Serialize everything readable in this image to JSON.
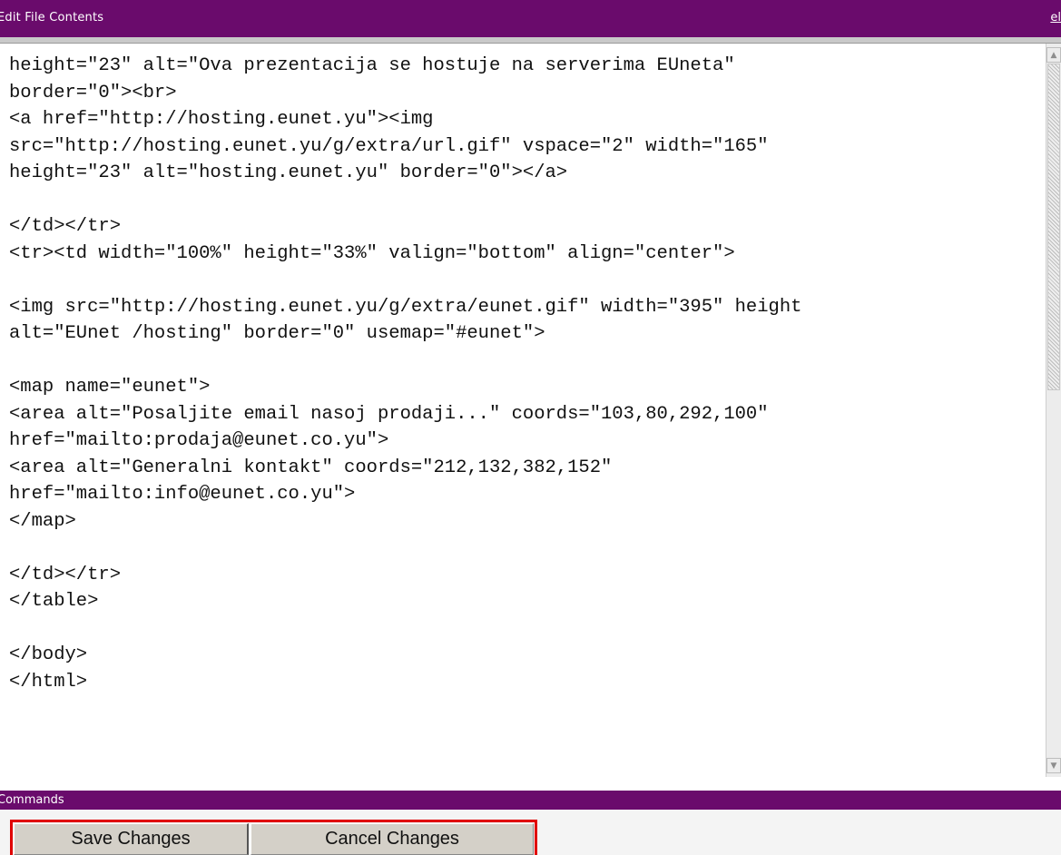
{
  "header": {
    "title": "Edit File Contents",
    "help_link": "el"
  },
  "editor": {
    "content": "height=\"23\" alt=\"Ova prezentacija se hostuje na serverima EUneta\"\nborder=\"0\"><br>\n<a href=\"http://hosting.eunet.yu\"><img\nsrc=\"http://hosting.eunet.yu/g/extra/url.gif\" vspace=\"2\" width=\"165\"\nheight=\"23\" alt=\"hosting.eunet.yu\" border=\"0\"></a>\n\n</td></tr>\n<tr><td width=\"100%\" height=\"33%\" valign=\"bottom\" align=\"center\">\n\n<img src=\"http://hosting.eunet.yu/g/extra/eunet.gif\" width=\"395\" height\nalt=\"EUnet /hosting\" border=\"0\" usemap=\"#eunet\">\n\n<map name=\"eunet\">\n<area alt=\"Posaljite email nasoj prodaji...\" coords=\"103,80,292,100\"\nhref=\"mailto:prodaja@eunet.co.yu\">\n<area alt=\"Generalni kontakt\" coords=\"212,132,382,152\"\nhref=\"mailto:info@eunet.co.yu\">\n</map>\n\n</td></tr>\n</table>\n\n</body>\n</html>"
  },
  "commands": {
    "title": "Commands",
    "save_label": "Save Changes",
    "cancel_label": "Cancel Changes"
  },
  "colors": {
    "header_bar": "#6a0b6c",
    "highlight_frame": "#e00000",
    "button_face": "#d4d0c8"
  },
  "icons": {
    "scroll_up": "triangle-up-icon",
    "scroll_down": "triangle-down-icon"
  }
}
